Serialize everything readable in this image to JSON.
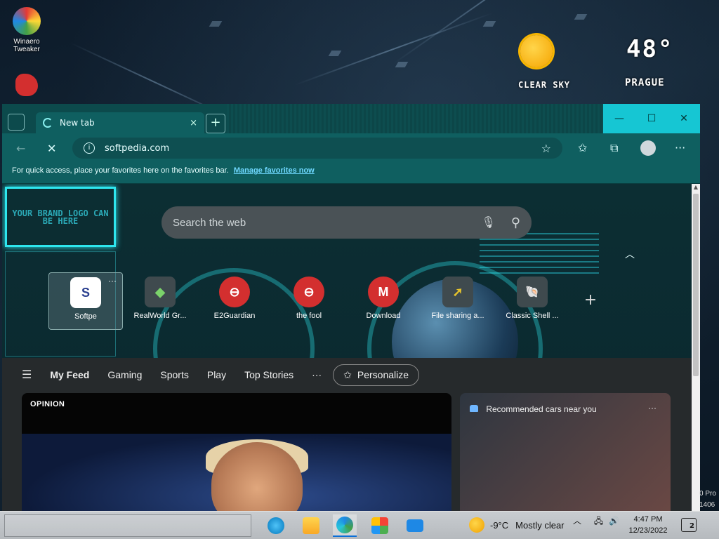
{
  "desktop": {
    "icons": [
      {
        "label": "Winaero Tweaker"
      }
    ],
    "weather_widget": {
      "condition": "CLEAR SKY",
      "temperature": "48°",
      "city": "PRAGUE"
    }
  },
  "browser": {
    "tab": {
      "title": "New tab",
      "close": "×"
    },
    "new_tab_button": "+",
    "window_controls": {
      "minimize": "—",
      "maximize": "☐",
      "close": "✕"
    },
    "address": {
      "url": "softpedia.com",
      "info": "i"
    },
    "favorites_bar": {
      "message": "For quick access, place your favorites here on the favorites bar.",
      "link": "Manage favorites now"
    }
  },
  "new_tab_page": {
    "brand_logo_text": "YOUR BRAND LOGO CAN BE HERE",
    "search_placeholder": "Search the web",
    "quick_links": [
      {
        "label": "Softpe",
        "tile": "S",
        "tile_color": "#2a3f8f"
      },
      {
        "label": "RealWorld Gr...",
        "tile": "◆",
        "tile_color": "#3f4a4e"
      },
      {
        "label": "E2Guardian",
        "tile": "⊖",
        "tile_color": "#d22"
      },
      {
        "label": "the fool",
        "tile": "⊖",
        "tile_color": "#d22"
      },
      {
        "label": "Download",
        "tile": "M",
        "tile_color": "#d22"
      },
      {
        "label": "File sharing a...",
        "tile": "➚",
        "tile_color": "#3f4a4e"
      },
      {
        "label": "Classic Shell ...",
        "tile": "🐚",
        "tile_color": "#3f4a4e"
      }
    ],
    "add_link": "+",
    "feed_nav": {
      "items": [
        "My Feed",
        "Gaming",
        "Sports",
        "Play",
        "Top Stories"
      ],
      "more": "···",
      "personalize": "Personalize"
    },
    "main_card": {
      "label": "OPINION"
    },
    "side_card": {
      "title": "Recommended cars near you",
      "more": "···"
    }
  },
  "watermark": {
    "line1": "0 Pro",
    "line2": "1406"
  },
  "taskbar": {
    "weather": {
      "temperature": "-9°C",
      "condition": "Mostly clear"
    },
    "clock": {
      "time": "4:47 PM",
      "date": "12/23/2022"
    },
    "notification_count": "2"
  },
  "colors": {
    "accent": "#16c6d3",
    "tab_bg": "#0f5f60",
    "link": "#6fd8ff"
  }
}
